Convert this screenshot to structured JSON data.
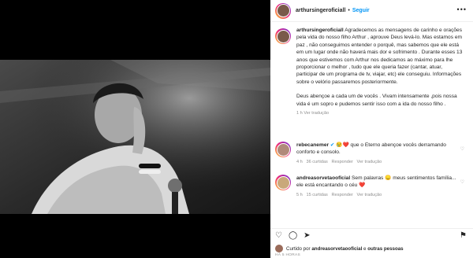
{
  "post": {
    "username": "arthursingeroficiall",
    "follow_label": "Seguir",
    "more_label": "•••",
    "caption_username": "arthursingeroficiall",
    "caption_p1": "Agradecemos as mensagens de carinho e orações pela vida do nosso filho Arthur , aprouve Deus levá-lo. Mas estamos em paz , não conseguimos entender o porquê, mas sabemos que ele está em um lugar onde não haverá mais dor e sofrimento . Durante esses 13 anos que estivemos com Arthur nos dedicamos ao máximo para lhe proporcionar o melhor , tudo que ele queria fazer (cantar, atuar, participar de um programa de tv, viajar, etc) ele conseguiu. Informações sobre o velório passaremos posteriormente.",
    "caption_p2": "Deus abençoe a cada um de vocês . Vivam intensamente ,pois nossa vida é um sopro e pudemos sentir isso com a ida do nosso filho .",
    "caption_meta": "1 h   Ver tradução"
  },
  "comments": [
    {
      "username": "rebecanemer",
      "verified_icon": "verified-badge",
      "emojis": "😢❤️",
      "text": "que o Eterno abençoe vocês derramando conforto e consolo.",
      "time": "4 h",
      "likes": "36 curtidas",
      "reply": "Responder",
      "translate": "Ver tradução"
    },
    {
      "username": "andreasorvetaooficial",
      "text_before": "Sem palavras",
      "emoji1": "😞",
      "text_after": "meus sentimentos família... ele está encantando o céu",
      "emoji2": "❤️",
      "time": "5 h",
      "likes": "15 curtidas",
      "reply": "Responder",
      "translate": "Ver tradução"
    }
  ],
  "footer": {
    "liked_prefix": "Curtido por",
    "liked_user": "andreasorvetaooficial",
    "liked_mid": "e",
    "liked_others": "outras pessoas",
    "timestamp": "HÁ 5 HORAS"
  },
  "icons": {
    "like": "heart-icon",
    "comment": "comment-icon",
    "share": "share-icon",
    "save": "bookmark-icon"
  }
}
